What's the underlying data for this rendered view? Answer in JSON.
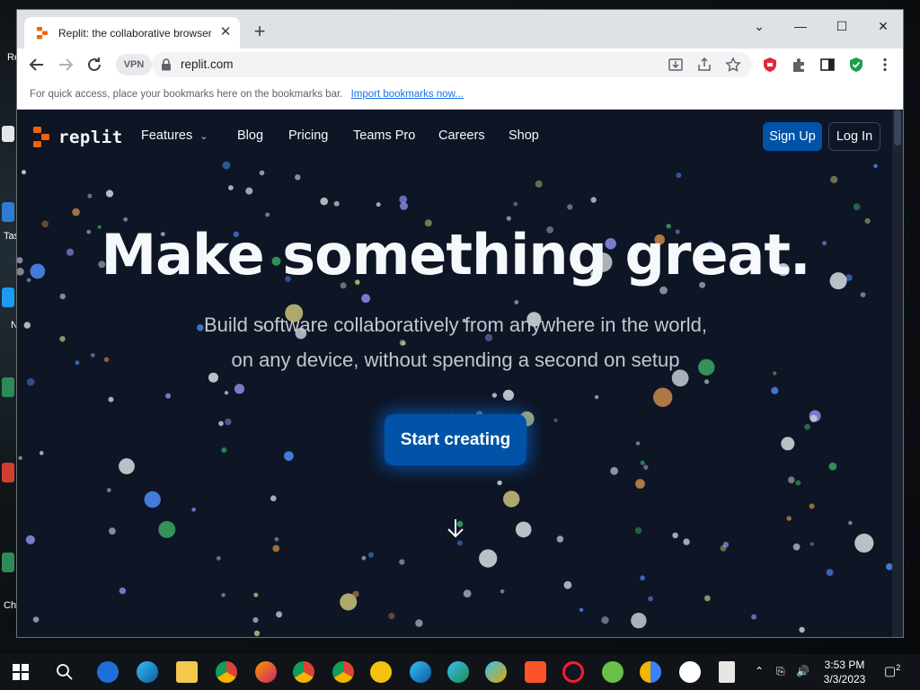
{
  "desktop": {
    "labels": [
      "Re",
      "Tas",
      "N",
      "Ch"
    ]
  },
  "browser": {
    "tab_title": "Replit: the collaborative browser",
    "tab_close": "✕",
    "new_tab": "+",
    "window_controls": {
      "dropdown": "⌄",
      "minimize": "—",
      "maximize": "☐",
      "close": "✕"
    },
    "vpn": "VPN",
    "url": "replit.com",
    "bookmarks_hint": "For quick access, place your bookmarks here on the bookmarks bar.",
    "import_bookmarks": "Import bookmarks now..."
  },
  "site": {
    "logo_text": "replit",
    "nav": [
      {
        "label": "Features"
      },
      {
        "label": "Blog"
      },
      {
        "label": "Pricing"
      },
      {
        "label": "Teams Pro"
      },
      {
        "label": "Careers"
      },
      {
        "label": "Shop"
      }
    ],
    "signup": "Sign Up",
    "login": "Log In",
    "hero_title": "Make something great.",
    "hero_sub_line1": "Build software collaboratively from anywhere in the world,",
    "hero_sub_line2": "on any device, without spending a second on setup",
    "cta": "Start creating"
  },
  "colors": {
    "page_bg": "#0e1525",
    "brand_orange": "#f26207",
    "button_blue": "#0053a6"
  },
  "taskbar": {
    "time": "3:53 PM",
    "date": "3/3/2023",
    "notifications": "2"
  }
}
